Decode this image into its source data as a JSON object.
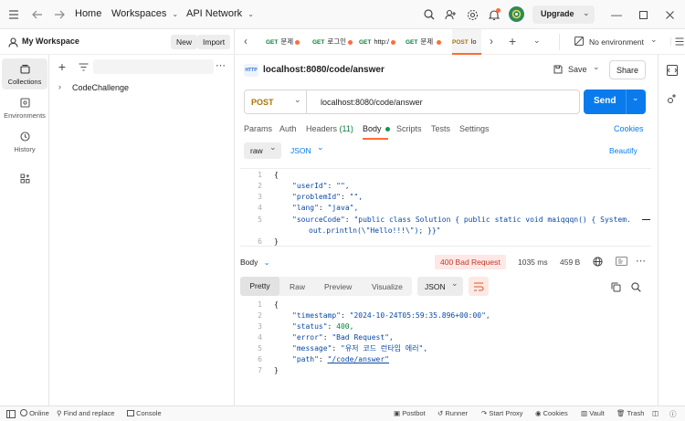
{
  "titlebar": {
    "home": "Home",
    "workspaces": "Workspaces",
    "api_network": "API Network",
    "upgrade": "Upgrade"
  },
  "workspace": {
    "name": "My Workspace",
    "new": "New",
    "import": "Import"
  },
  "rail": {
    "collections": "Collections",
    "environments": "Environments",
    "history": "History"
  },
  "collections": {
    "items": [
      {
        "name": "CodeChallenge"
      }
    ]
  },
  "tabs": [
    {
      "method": "GET",
      "label": "문제",
      "dirty": true
    },
    {
      "method": "GET",
      "label": "로그인",
      "dirty": true
    },
    {
      "method": "GET",
      "label": "http:/",
      "dirty": true
    },
    {
      "method": "GET",
      "label": "문제 ",
      "dirty": true
    },
    {
      "method": "POST",
      "label": "lo",
      "dirty": false
    }
  ],
  "environment": {
    "label": "No environment"
  },
  "request": {
    "title": "localhost:8080/code/answer",
    "save": "Save",
    "share": "Share",
    "method": "POST",
    "url": "localhost:8080/code/answer",
    "send": "Send",
    "subtabs": {
      "params": "Params",
      "auth": "Auth",
      "headers": "Headers",
      "headers_count": "(11)",
      "body": "Body",
      "scripts": "Scripts",
      "tests": "Tests",
      "settings": "Settings",
      "cookies": "Cookies"
    },
    "body_mode": "raw",
    "body_format": "JSON",
    "beautify": "Beautify",
    "body_lines": [
      {
        "n": "1",
        "text": "{"
      },
      {
        "n": "2",
        "key": "\"userId\"",
        "val": "\"\","
      },
      {
        "n": "3",
        "key": "\"problemId\"",
        "val": "\"\","
      },
      {
        "n": "4",
        "key": "\"lang\"",
        "val": "\"java\","
      },
      {
        "n": "5",
        "key": "\"sourceCode\"",
        "val": "\"public class Solution { public static void maiqqqn() { System."
      },
      {
        "n": "",
        "text": "out.println(\\\"Hello!!!\\\"); }}\""
      },
      {
        "n": "6",
        "text": "}"
      }
    ]
  },
  "response": {
    "label": "Body",
    "status": "400 Bad Request",
    "time": "1035 ms",
    "size": "459 B",
    "views": {
      "pretty": "Pretty",
      "raw": "Raw",
      "preview": "Preview",
      "visualize": "Visualize"
    },
    "format": "JSON",
    "lines": [
      {
        "n": "1",
        "text": "{"
      },
      {
        "n": "2",
        "key": "\"timestamp\"",
        "val": "\"2024-10-24T05:59:35.896+00:00\","
      },
      {
        "n": "3",
        "key": "\"status\"",
        "val": "400,"
      },
      {
        "n": "4",
        "key": "\"error\"",
        "val": "\"Bad Request\","
      },
      {
        "n": "5",
        "key": "\"message\"",
        "val": "\"유저 코드 런타임 에러\","
      },
      {
        "n": "6",
        "key": "\"path\"",
        "val": "\"/code/answer\"",
        "link": true
      },
      {
        "n": "7",
        "text": "}"
      }
    ]
  },
  "statusbar": {
    "online": "Online",
    "find_replace": "Find and replace",
    "console": "Console",
    "postbot": "Postbot",
    "runner": "Runner",
    "start_proxy": "Start Proxy",
    "cookies": "Cookies",
    "vault": "Vault",
    "trash": "Trash"
  },
  "colors": {
    "accent": "#ff6c37",
    "send": "#097bed",
    "post": "#a9730a",
    "get": "#0a7f3a",
    "error": "#d63031",
    "error_bg": "#fde8e6"
  }
}
